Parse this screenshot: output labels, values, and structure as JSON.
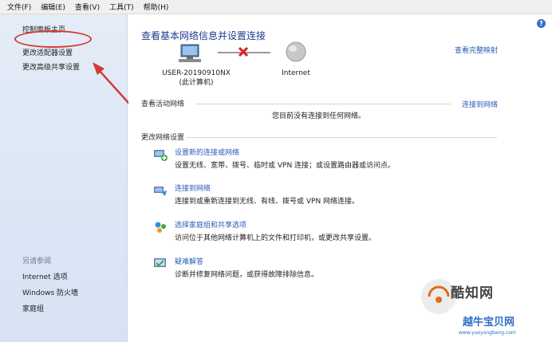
{
  "menu": [
    "文件(F)",
    "编辑(E)",
    "查看(V)",
    "工具(T)",
    "帮助(H)"
  ],
  "sidebar": {
    "links": [
      "控制面板主页",
      "更改适配器设置",
      "更改高级共享设置"
    ],
    "see_also_head": "另请参阅",
    "see_also": [
      "Internet 选项",
      "Windows 防火墙",
      "家庭组"
    ]
  },
  "main": {
    "help": "?",
    "title": "查看基本网络信息并设置连接",
    "full_map": "查看完整映射",
    "computer_name": "USER-20190910NX",
    "computer_sub": "(此计算机)",
    "internet_label": "Internet",
    "active_head": "查看活动网络",
    "connect_link": "连接到网络",
    "no_conn": "您目前没有连接到任何网络。",
    "change_head": "更改网络设置",
    "tasks": [
      {
        "title": "设置新的连接或网络",
        "desc": "设置无线、宽带、拨号、临时或 VPN 连接；或设置路由器或访问点。"
      },
      {
        "title": "连接到网络",
        "desc": "连接到或重新连接到无线、有线、拨号或 VPN 网络连接。"
      },
      {
        "title": "选择家庭组和共享选项",
        "desc": "访问位于其他网络计算机上的文件和打印机，或更改共享设置。"
      },
      {
        "title": "疑难解答",
        "desc": "诊断并修复网络问题，或获得故障排除信息。"
      }
    ]
  },
  "watermark": {
    "brand": "酷知网",
    "sub": "越牛宝贝网",
    "url": "www.yueyangbang.com"
  },
  "colors": {
    "accent_link": "#2a5bb8",
    "title": "#1e3b8f",
    "annotation": "#d33a32",
    "sidebar_bg": "#dbe6f5"
  }
}
